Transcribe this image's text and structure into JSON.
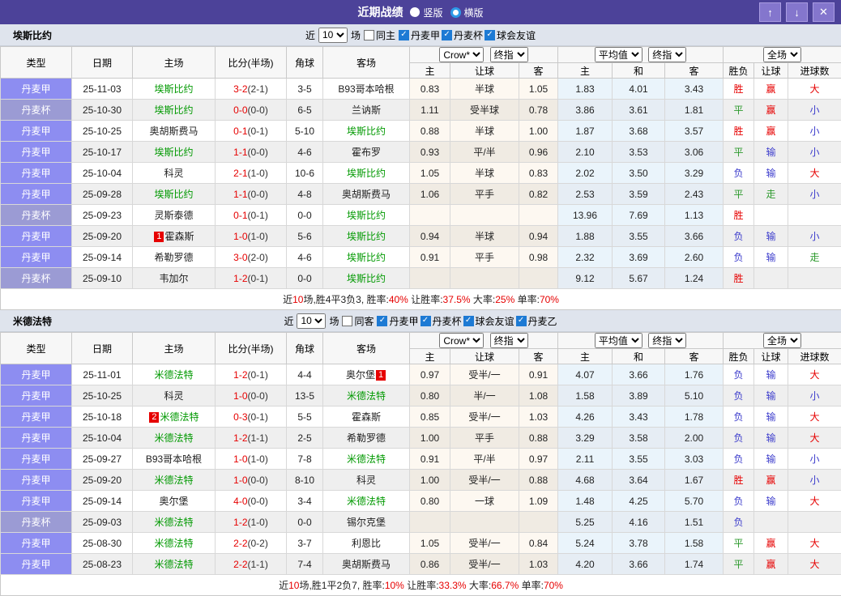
{
  "header": {
    "title": "近期战绩",
    "radio_vertical": "竖版",
    "radio_horizontal": "横版",
    "buttons": {
      "up": "↑",
      "down": "↓",
      "close": "✕"
    }
  },
  "colors": {
    "titlebar": "#4c4299",
    "button": "#8476cd",
    "section_bar": "#dfe4ed",
    "league_jia": "#8d8df1",
    "league_bei": "#9b9bd4",
    "highlight_team": "#009900",
    "score_red": "#e60000",
    "win_red": "#e60000",
    "draw_green": "#2d9a2d",
    "lose_blue": "#3c3ccc",
    "checkbox_blue": "#1d7ad4",
    "radio_ring_blue": "#2d9ae8"
  },
  "table": {
    "cols": [
      "类型",
      "日期",
      "主场",
      "比分(半场)",
      "角球",
      "客场"
    ],
    "sub_cols": [
      "主",
      "让球",
      "客",
      "主",
      "和",
      "客",
      "胜负",
      "让球",
      "进球数"
    ],
    "selects": {
      "bookmaker": "Crow*",
      "final_a": "终指",
      "average": "平均值",
      "final_b": "终指",
      "scope": "全场"
    }
  },
  "sections": [
    {
      "team": "埃斯比约",
      "filter": {
        "prefix": "近",
        "count": "10",
        "suffix": "场",
        "same": {
          "label": "同主",
          "checked": false
        },
        "leagues": [
          {
            "label": "丹麦甲",
            "checked": true
          },
          {
            "label": "丹麦杯",
            "checked": true
          },
          {
            "label": "球会友谊",
            "checked": true
          }
        ]
      },
      "rows": [
        {
          "lg": "jia",
          "league": "丹麦甲",
          "date": "25-11-03",
          "home": {
            "name": "埃斯比约",
            "green": true
          },
          "score": "3-2",
          "half": "(2-1)",
          "corner": "3-5",
          "away": {
            "name": "B93哥本哈根"
          },
          "let": [
            "0.83",
            "半球",
            "1.05"
          ],
          "avg": [
            "1.83",
            "4.01",
            "3.43"
          ],
          "res": {
            "t": "胜",
            "c": "r"
          },
          "hres": {
            "t": "赢",
            "c": "r"
          },
          "gres": {
            "t": "大",
            "c": "r"
          }
        },
        {
          "lg": "bei",
          "league": "丹麦杯",
          "date": "25-10-30",
          "home": {
            "name": "埃斯比约",
            "green": true
          },
          "score": "0-0",
          "half": "(0-0)",
          "corner": "6-5",
          "away": {
            "name": "兰讷斯"
          },
          "let": [
            "1.11",
            "受半球",
            "0.78"
          ],
          "avg": [
            "3.86",
            "3.61",
            "1.81"
          ],
          "res": {
            "t": "平",
            "c": "g"
          },
          "hres": {
            "t": "赢",
            "c": "r"
          },
          "gres": {
            "t": "小",
            "c": "b"
          }
        },
        {
          "lg": "jia",
          "league": "丹麦甲",
          "date": "25-10-25",
          "home": {
            "name": "奥胡斯费马"
          },
          "score": "0-1",
          "half": "(0-1)",
          "corner": "5-10",
          "away": {
            "name": "埃斯比约",
            "green": true
          },
          "let": [
            "0.88",
            "半球",
            "1.00"
          ],
          "avg": [
            "1.87",
            "3.68",
            "3.57"
          ],
          "res": {
            "t": "胜",
            "c": "r"
          },
          "hres": {
            "t": "赢",
            "c": "r"
          },
          "gres": {
            "t": "小",
            "c": "b"
          }
        },
        {
          "lg": "jia",
          "league": "丹麦甲",
          "date": "25-10-17",
          "home": {
            "name": "埃斯比约",
            "green": true
          },
          "score": "1-1",
          "half": "(0-0)",
          "corner": "4-6",
          "away": {
            "name": "霍布罗"
          },
          "let": [
            "0.93",
            "平/半",
            "0.96"
          ],
          "avg": [
            "2.10",
            "3.53",
            "3.06"
          ],
          "res": {
            "t": "平",
            "c": "g"
          },
          "hres": {
            "t": "输",
            "c": "b"
          },
          "gres": {
            "t": "小",
            "c": "b"
          }
        },
        {
          "lg": "jia",
          "league": "丹麦甲",
          "date": "25-10-04",
          "home": {
            "name": "科灵"
          },
          "score": "2-1",
          "half": "(1-0)",
          "corner": "10-6",
          "away": {
            "name": "埃斯比约",
            "green": true
          },
          "let": [
            "1.05",
            "半球",
            "0.83"
          ],
          "avg": [
            "2.02",
            "3.50",
            "3.29"
          ],
          "res": {
            "t": "负",
            "c": "b"
          },
          "hres": {
            "t": "输",
            "c": "b"
          },
          "gres": {
            "t": "大",
            "c": "r"
          }
        },
        {
          "lg": "jia",
          "league": "丹麦甲",
          "date": "25-09-28",
          "home": {
            "name": "埃斯比约",
            "green": true
          },
          "score": "1-1",
          "half": "(0-0)",
          "corner": "4-8",
          "away": {
            "name": "奥胡斯费马"
          },
          "let": [
            "1.06",
            "平手",
            "0.82"
          ],
          "avg": [
            "2.53",
            "3.59",
            "2.43"
          ],
          "res": {
            "t": "平",
            "c": "g"
          },
          "hres": {
            "t": "走",
            "c": "g"
          },
          "gres": {
            "t": "小",
            "c": "b"
          }
        },
        {
          "lg": "bei",
          "league": "丹麦杯",
          "date": "25-09-23",
          "home": {
            "name": "灵斯泰德"
          },
          "score": "0-1",
          "half": "(0-1)",
          "corner": "0-0",
          "away": {
            "name": "埃斯比约",
            "green": true
          },
          "let": [
            "",
            "",
            ""
          ],
          "avg": [
            "13.96",
            "7.69",
            "1.13"
          ],
          "res": {
            "t": "胜",
            "c": "r"
          },
          "hres": {
            "t": "",
            "c": ""
          },
          "gres": {
            "t": "",
            "c": ""
          }
        },
        {
          "lg": "jia",
          "league": "丹麦甲",
          "date": "25-09-20",
          "home": {
            "name": "霍森斯",
            "badge": "1",
            "badge_pos": "before"
          },
          "score": "1-0",
          "half": "(1-0)",
          "corner": "5-6",
          "away": {
            "name": "埃斯比约",
            "green": true
          },
          "let": [
            "0.94",
            "半球",
            "0.94"
          ],
          "avg": [
            "1.88",
            "3.55",
            "3.66"
          ],
          "res": {
            "t": "负",
            "c": "b"
          },
          "hres": {
            "t": "输",
            "c": "b"
          },
          "gres": {
            "t": "小",
            "c": "b"
          }
        },
        {
          "lg": "jia",
          "league": "丹麦甲",
          "date": "25-09-14",
          "home": {
            "name": "希勒罗德"
          },
          "score": "3-0",
          "half": "(2-0)",
          "corner": "4-6",
          "away": {
            "name": "埃斯比约",
            "green": true
          },
          "let": [
            "0.91",
            "平手",
            "0.98"
          ],
          "avg": [
            "2.32",
            "3.69",
            "2.60"
          ],
          "res": {
            "t": "负",
            "c": "b"
          },
          "hres": {
            "t": "输",
            "c": "b"
          },
          "gres": {
            "t": "走",
            "c": "g"
          }
        },
        {
          "lg": "bei",
          "league": "丹麦杯",
          "date": "25-09-10",
          "home": {
            "name": "韦加尔"
          },
          "score": "1-2",
          "half": "(0-1)",
          "corner": "0-0",
          "away": {
            "name": "埃斯比约",
            "green": true
          },
          "let": [
            "",
            "",
            ""
          ],
          "avg": [
            "9.12",
            "5.67",
            "1.24"
          ],
          "res": {
            "t": "胜",
            "c": "r"
          },
          "hres": {
            "t": "",
            "c": ""
          },
          "gres": {
            "t": "",
            "c": ""
          }
        }
      ],
      "summary": [
        {
          "t": "近"
        },
        {
          "t": "10",
          "c": "r"
        },
        {
          "t": "场,胜4平3负3, 胜率:"
        },
        {
          "t": "40%",
          "c": "r"
        },
        {
          "t": " 让胜率:"
        },
        {
          "t": "37.5%",
          "c": "r"
        },
        {
          "t": " 大率:"
        },
        {
          "t": "25%",
          "c": "r"
        },
        {
          "t": " 单率:"
        },
        {
          "t": "70%",
          "c": "r"
        }
      ]
    },
    {
      "team": "米德法特",
      "filter": {
        "prefix": "近",
        "count": "10",
        "suffix": "场",
        "same": {
          "label": "同客",
          "checked": false
        },
        "leagues": [
          {
            "label": "丹麦甲",
            "checked": true
          },
          {
            "label": "丹麦杯",
            "checked": true
          },
          {
            "label": "球会友谊",
            "checked": true
          },
          {
            "label": "丹麦乙",
            "checked": true
          }
        ]
      },
      "rows": [
        {
          "lg": "jia",
          "league": "丹麦甲",
          "date": "25-11-01",
          "home": {
            "name": "米德法特",
            "green": true
          },
          "score": "1-2",
          "half": "(0-1)",
          "corner": "4-4",
          "away": {
            "name": "奥尔堡",
            "badge": "1",
            "badge_pos": "after"
          },
          "let": [
            "0.97",
            "受半/一",
            "0.91"
          ],
          "avg": [
            "4.07",
            "3.66",
            "1.76"
          ],
          "res": {
            "t": "负",
            "c": "b"
          },
          "hres": {
            "t": "输",
            "c": "b"
          },
          "gres": {
            "t": "大",
            "c": "r"
          }
        },
        {
          "lg": "jia",
          "league": "丹麦甲",
          "date": "25-10-25",
          "home": {
            "name": "科灵"
          },
          "score": "1-0",
          "half": "(0-0)",
          "corner": "13-5",
          "away": {
            "name": "米德法特",
            "green": true
          },
          "let": [
            "0.80",
            "半/一",
            "1.08"
          ],
          "avg": [
            "1.58",
            "3.89",
            "5.10"
          ],
          "res": {
            "t": "负",
            "c": "b"
          },
          "hres": {
            "t": "输",
            "c": "b"
          },
          "gres": {
            "t": "小",
            "c": "b"
          }
        },
        {
          "lg": "jia",
          "league": "丹麦甲",
          "date": "25-10-18",
          "home": {
            "name": "米德法特",
            "green": true,
            "badge": "2",
            "badge_pos": "before"
          },
          "score": "0-3",
          "half": "(0-1)",
          "corner": "5-5",
          "away": {
            "name": "霍森斯"
          },
          "let": [
            "0.85",
            "受半/一",
            "1.03"
          ],
          "avg": [
            "4.26",
            "3.43",
            "1.78"
          ],
          "res": {
            "t": "负",
            "c": "b"
          },
          "hres": {
            "t": "输",
            "c": "b"
          },
          "gres": {
            "t": "大",
            "c": "r"
          }
        },
        {
          "lg": "jia",
          "league": "丹麦甲",
          "date": "25-10-04",
          "home": {
            "name": "米德法特",
            "green": true
          },
          "score": "1-2",
          "half": "(1-1)",
          "corner": "2-5",
          "away": {
            "name": "希勒罗德"
          },
          "let": [
            "1.00",
            "平手",
            "0.88"
          ],
          "avg": [
            "3.29",
            "3.58",
            "2.00"
          ],
          "res": {
            "t": "负",
            "c": "b"
          },
          "hres": {
            "t": "输",
            "c": "b"
          },
          "gres": {
            "t": "大",
            "c": "r"
          }
        },
        {
          "lg": "jia",
          "league": "丹麦甲",
          "date": "25-09-27",
          "home": {
            "name": "B93哥本哈根"
          },
          "score": "1-0",
          "half": "(1-0)",
          "corner": "7-8",
          "away": {
            "name": "米德法特",
            "green": true
          },
          "let": [
            "0.91",
            "平/半",
            "0.97"
          ],
          "avg": [
            "2.11",
            "3.55",
            "3.03"
          ],
          "res": {
            "t": "负",
            "c": "b"
          },
          "hres": {
            "t": "输",
            "c": "b"
          },
          "gres": {
            "t": "小",
            "c": "b"
          }
        },
        {
          "lg": "jia",
          "league": "丹麦甲",
          "date": "25-09-20",
          "home": {
            "name": "米德法特",
            "green": true
          },
          "score": "1-0",
          "half": "(0-0)",
          "corner": "8-10",
          "away": {
            "name": "科灵"
          },
          "let": [
            "1.00",
            "受半/一",
            "0.88"
          ],
          "avg": [
            "4.68",
            "3.64",
            "1.67"
          ],
          "res": {
            "t": "胜",
            "c": "r"
          },
          "hres": {
            "t": "赢",
            "c": "r"
          },
          "gres": {
            "t": "小",
            "c": "b"
          }
        },
        {
          "lg": "jia",
          "league": "丹麦甲",
          "date": "25-09-14",
          "home": {
            "name": "奥尔堡"
          },
          "score": "4-0",
          "half": "(0-0)",
          "corner": "3-4",
          "away": {
            "name": "米德法特",
            "green": true
          },
          "let": [
            "0.80",
            "一球",
            "1.09"
          ],
          "avg": [
            "1.48",
            "4.25",
            "5.70"
          ],
          "res": {
            "t": "负",
            "c": "b"
          },
          "hres": {
            "t": "输",
            "c": "b"
          },
          "gres": {
            "t": "大",
            "c": "r"
          }
        },
        {
          "lg": "bei",
          "league": "丹麦杯",
          "date": "25-09-03",
          "home": {
            "name": "米德法特",
            "green": true
          },
          "score": "1-2",
          "half": "(1-0)",
          "corner": "0-0",
          "away": {
            "name": "锡尔克堡"
          },
          "let": [
            "",
            "",
            ""
          ],
          "avg": [
            "5.25",
            "4.16",
            "1.51"
          ],
          "res": {
            "t": "负",
            "c": "b"
          },
          "hres": {
            "t": "",
            "c": ""
          },
          "gres": {
            "t": "",
            "c": ""
          }
        },
        {
          "lg": "jia",
          "league": "丹麦甲",
          "date": "25-08-30",
          "home": {
            "name": "米德法特",
            "green": true
          },
          "score": "2-2",
          "half": "(0-2)",
          "corner": "3-7",
          "away": {
            "name": "利恩比"
          },
          "let": [
            "1.05",
            "受半/一",
            "0.84"
          ],
          "avg": [
            "5.24",
            "3.78",
            "1.58"
          ],
          "res": {
            "t": "平",
            "c": "g"
          },
          "hres": {
            "t": "赢",
            "c": "r"
          },
          "gres": {
            "t": "大",
            "c": "r"
          }
        },
        {
          "lg": "jia",
          "league": "丹麦甲",
          "date": "25-08-23",
          "home": {
            "name": "米德法特",
            "green": true
          },
          "score": "2-2",
          "half": "(1-1)",
          "corner": "7-4",
          "away": {
            "name": "奥胡斯费马"
          },
          "let": [
            "0.86",
            "受半/一",
            "1.03"
          ],
          "avg": [
            "4.20",
            "3.66",
            "1.74"
          ],
          "res": {
            "t": "平",
            "c": "g"
          },
          "hres": {
            "t": "赢",
            "c": "r"
          },
          "gres": {
            "t": "大",
            "c": "r"
          }
        }
      ],
      "summary": [
        {
          "t": "近"
        },
        {
          "t": "10",
          "c": "r"
        },
        {
          "t": "场,胜1平2负7, 胜率:"
        },
        {
          "t": "10%",
          "c": "r"
        },
        {
          "t": " 让胜率:"
        },
        {
          "t": "33.3%",
          "c": "r"
        },
        {
          "t": " 大率:"
        },
        {
          "t": "66.7%",
          "c": "r"
        },
        {
          "t": " 单率:"
        },
        {
          "t": "70%",
          "c": "r"
        }
      ]
    }
  ]
}
